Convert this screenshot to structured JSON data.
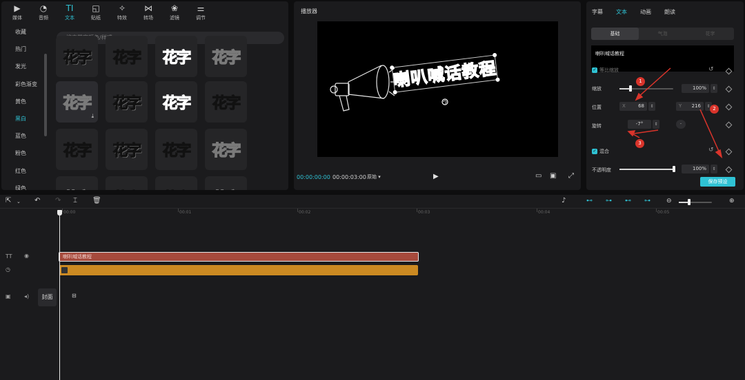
{
  "toolbar": {
    "tabs": [
      {
        "icon": "media-icon",
        "label": "媒体"
      },
      {
        "icon": "audio-icon",
        "label": "音频"
      },
      {
        "icon": "text-icon",
        "label": "文本"
      },
      {
        "icon": "sticker-icon",
        "label": "贴纸"
      },
      {
        "icon": "effects-icon",
        "label": "特效"
      },
      {
        "icon": "transition-icon",
        "label": "转场"
      },
      {
        "icon": "filter-icon",
        "label": "滤镜"
      },
      {
        "icon": "adjust-icon",
        "label": "调节"
      }
    ],
    "active": "文本"
  },
  "categories": {
    "items": [
      "收藏",
      "热门",
      "发光",
      "彩色渐变",
      "黄色",
      "黑白",
      "蓝色",
      "粉色",
      "红色",
      "绿色"
    ],
    "active": "黑白"
  },
  "library": {
    "search_placeholder": "搜索花字颜色/样式",
    "tile_text": "花字",
    "download_icon": "download-icon"
  },
  "player": {
    "title": "播放器",
    "current_time": "00:00:00:00",
    "total_time": "00:00:03:00",
    "ratio_label": "原始 ▾",
    "overlay_text": "喇叭喊话教程",
    "accent_color": "#2fc2d4"
  },
  "inspector": {
    "tabs": [
      "字幕",
      "文本",
      "动画",
      "朗读"
    ],
    "active_tab": "文本",
    "segments": [
      "基础",
      "气泡",
      "花字"
    ],
    "active_segment": "基础",
    "text_value": "喇叭喊话教程",
    "uniform_scale_label": "等比缩放",
    "scale_label": "缩放",
    "scale_value": "100%",
    "position_label": "位置",
    "x_label": "X",
    "x_value": "68",
    "y_label": "Y",
    "y_value": "216",
    "rotate_label": "旋转",
    "rotate_value": "-7°",
    "blend_label": "混合",
    "opacity_label": "不透明度",
    "opacity_value": "100%",
    "save_label": "保存预设",
    "annotations": [
      "1",
      "2",
      "3"
    ],
    "annotation_color": "#d9342b"
  },
  "timeline": {
    "ticks": [
      "00:00",
      "00:01",
      "00:02",
      "00:03",
      "00:04",
      "00:05"
    ],
    "text_clip_label": "喇叭喊话教程",
    "cover_label": "封面",
    "text_track_label": "TT"
  }
}
